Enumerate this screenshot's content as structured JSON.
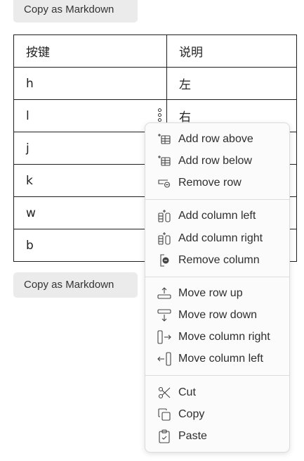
{
  "buttons": {
    "copy_top": "Copy as Markdown",
    "copy_bottom": "Copy as Markdown"
  },
  "table": {
    "headers": [
      "按键",
      "说明"
    ],
    "rows": [
      [
        "h",
        "左"
      ],
      [
        "l",
        "右"
      ],
      [
        "j",
        ""
      ],
      [
        "k",
        ""
      ],
      [
        "w",
        ""
      ],
      [
        "b",
        ""
      ]
    ]
  },
  "context_menu": {
    "items": [
      {
        "label": "Add row above",
        "icon": "add-row-above-icon"
      },
      {
        "label": "Add row below",
        "icon": "add-row-below-icon"
      },
      {
        "label": "Remove row",
        "icon": "remove-row-icon"
      },
      {
        "label": "Add column left",
        "icon": "add-column-left-icon"
      },
      {
        "label": "Add column right",
        "icon": "add-column-right-icon"
      },
      {
        "label": "Remove column",
        "icon": "remove-column-icon"
      },
      {
        "label": "Move row up",
        "icon": "move-row-up-icon"
      },
      {
        "label": "Move row down",
        "icon": "move-row-down-icon"
      },
      {
        "label": "Move column right",
        "icon": "move-column-right-icon"
      },
      {
        "label": "Move column left",
        "icon": "move-column-left-icon"
      },
      {
        "label": "Cut",
        "icon": "scissors-icon"
      },
      {
        "label": "Copy",
        "icon": "copy-icon"
      },
      {
        "label": "Paste",
        "icon": "clipboard-icon"
      }
    ]
  }
}
